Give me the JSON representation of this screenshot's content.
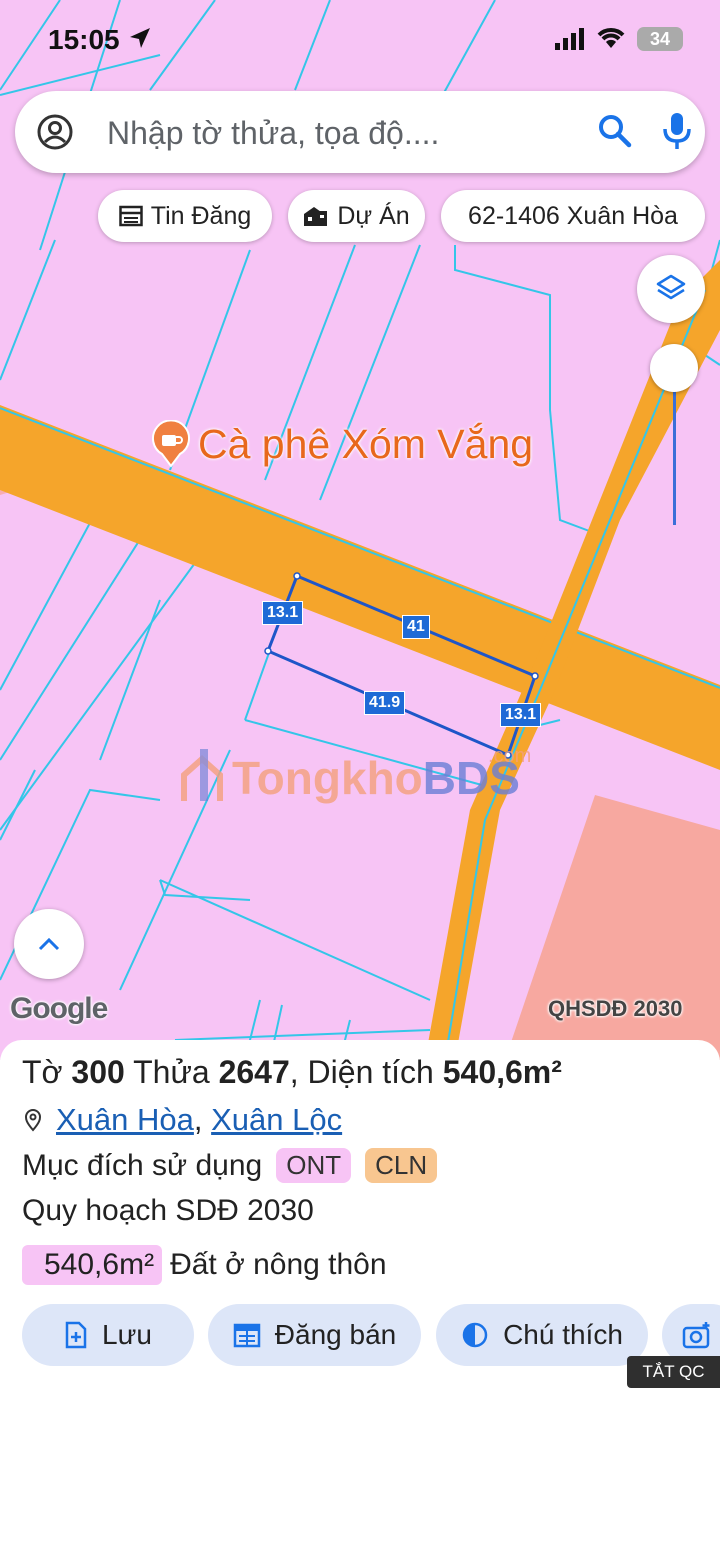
{
  "status": {
    "time": "15:05",
    "battery": "34"
  },
  "search": {
    "placeholder": "Nhập tờ thửa, tọa độ...."
  },
  "chips": {
    "news": "Tin Đăng",
    "projects": "Dự Án",
    "location": "62-1406 Xuân Hòa"
  },
  "map": {
    "poi_label": "Cà phê Xóm Vắng",
    "dims": {
      "top": "41",
      "left": "13.1",
      "bottom": "41.9",
      "right": "13.1"
    },
    "watermark": {
      "part1": "Tongkho",
      "part2": "BDS",
      "suffix": ".com"
    },
    "google": "Google",
    "plan_label": "QHSDĐ 2030"
  },
  "parcel": {
    "sheet_label": "Tờ",
    "sheet_no": "300",
    "parcel_label": "Thửa",
    "parcel_no": "2647",
    "area_label": ", Diện tích",
    "area": "540,6m²",
    "ward": "Xuân Hòa",
    "district": "Xuân Lộc",
    "purpose_label": "Mục đích sử dụng",
    "purpose_tags": [
      "ONT",
      "CLN"
    ],
    "plan_title": "Quy hoạch SDĐ 2030",
    "plan_area": "540,6m²",
    "plan_use": "Đất ở nông thôn"
  },
  "actions": {
    "save": "Lưu",
    "post": "Đăng bán",
    "legend": "Chú thích"
  },
  "ads_label": "TẮT QC",
  "colors": {
    "land": "#f7c4f5",
    "road": "#f5a52b",
    "boundary": "#34c6e8",
    "accent": "#1e6ad6"
  }
}
